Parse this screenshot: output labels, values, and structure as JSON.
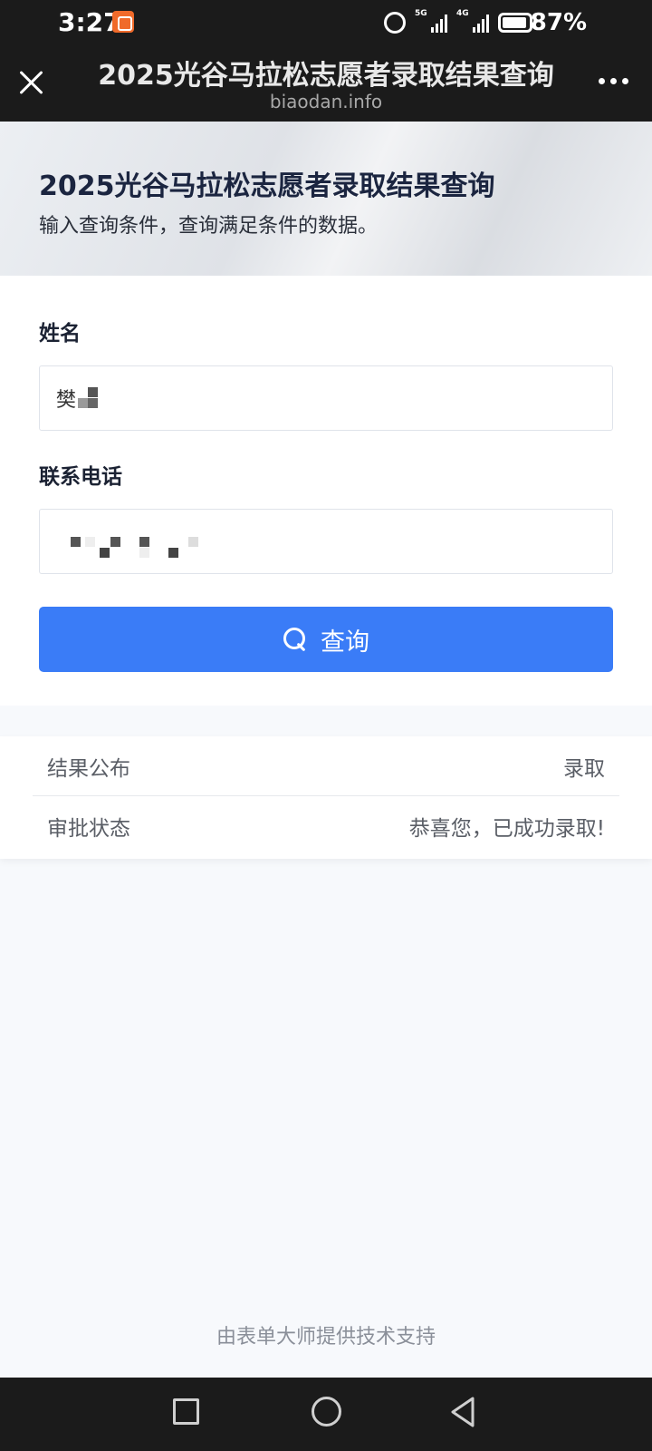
{
  "status_bar": {
    "time": "3:27",
    "network_1": "5G",
    "network_2": "4G",
    "battery_percent": "87%",
    "icons": [
      "app-notification-icon",
      "alarm-icon",
      "signal-icon",
      "battery-icon"
    ]
  },
  "browser": {
    "title": "2025光谷马拉松志愿者录取结果查询",
    "url": "biaodan.info",
    "icons": [
      "close-icon",
      "more-icon"
    ]
  },
  "banner": {
    "title": "2025光谷马拉松志愿者录取结果查询",
    "subtitle": "输入查询条件，查询满足条件的数据。"
  },
  "form": {
    "name_label": "姓名",
    "name_value": "樊",
    "phone_label": "联系电话",
    "query_button_label": "查询"
  },
  "results": {
    "rows": [
      {
        "key": "结果公布",
        "value": "录取"
      },
      {
        "key": "审批状态",
        "value": "恭喜您，已成功录取!"
      }
    ]
  },
  "footer": {
    "text": "由表单大师提供技术支持"
  },
  "colors": {
    "primary": "#3a7cf7",
    "topbar": "#1b1b1b",
    "page_bg": "#f7f9fc"
  }
}
